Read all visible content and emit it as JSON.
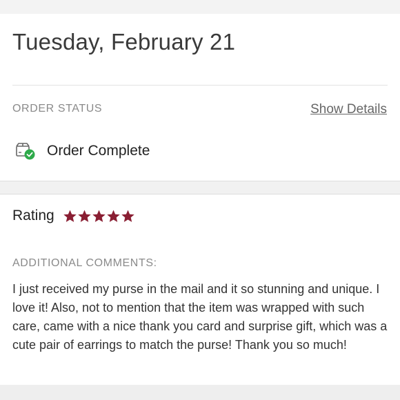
{
  "order": {
    "date": "Tuesday, February 21",
    "status_label": "ORDER STATUS",
    "show_details": "Show Details",
    "status_text": "Order Complete",
    "status_icon": "package-check-icon",
    "status_color": "#2eaa4a"
  },
  "review": {
    "rating_label": "Rating",
    "stars": 5,
    "star_color": "#8a1f33",
    "comments_label": "ADDITIONAL COMMENTS:",
    "comments_text": "I just received my purse in the mail and it so stunning and unique. I love it! Also, not to mention that the item was wrapped with such care, came with a nice thank you card and surprise gift, which was a cute pair of earrings to match the purse! Thank you so much!"
  }
}
